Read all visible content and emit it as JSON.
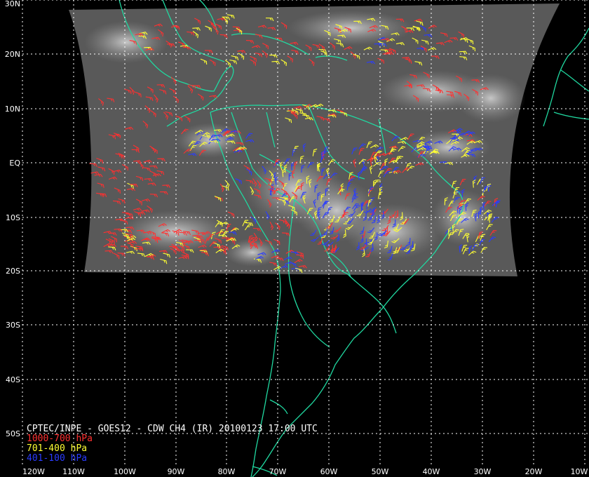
{
  "caption": {
    "title": "CPTEC/INPE - GOES12 - CDW CH4 (IR) 20100123 17:00 UTC",
    "legend": [
      {
        "label": "1000-700 hPa",
        "color": "#ff3030"
      },
      {
        "label": "701-400 hPa",
        "color": "#ffff33"
      },
      {
        "label": "401-100 hPa",
        "color": "#2a3cff"
      }
    ]
  },
  "axes": {
    "lat_labels": [
      "30N",
      "20N",
      "10N",
      "EQ",
      "10S",
      "20S",
      "30S",
      "40S",
      "50S"
    ],
    "lon_labels": [
      "120W",
      "110W",
      "100W",
      "90W",
      "80W",
      "70W",
      "60W",
      "50W",
      "40W",
      "30W",
      "20W",
      "10W"
    ]
  },
  "map": {
    "coastline_color": "#20d8a0",
    "grid_color": "#ffffff",
    "imagery_color": "#5a5a5a",
    "background": "#000000"
  }
}
